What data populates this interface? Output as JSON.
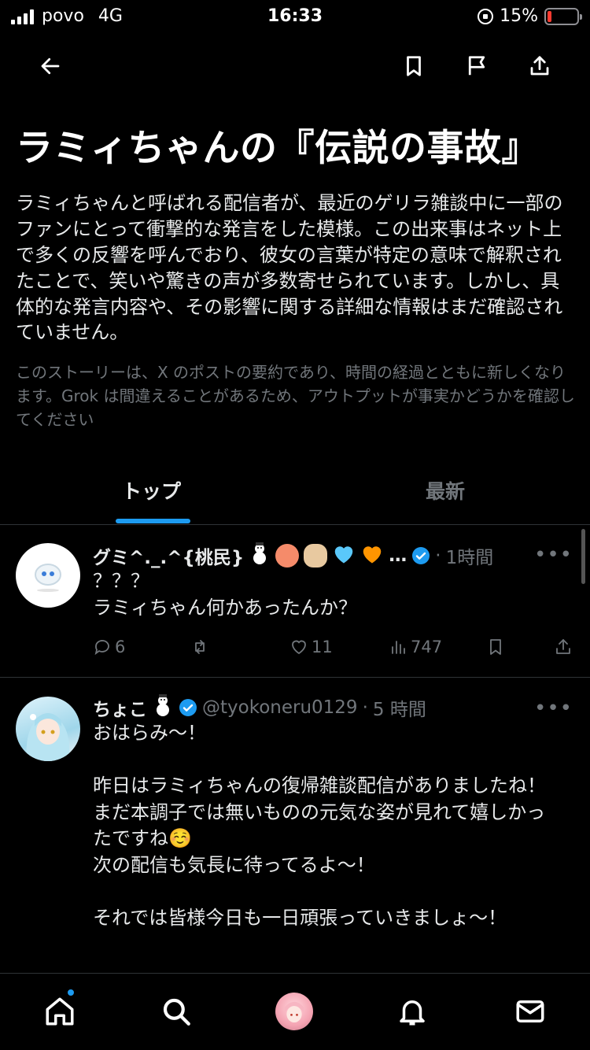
{
  "status": {
    "carrier": "povo",
    "network": "4G",
    "time": "16:33",
    "battery": "15%",
    "battery_level": 0.15
  },
  "headline": "ラミィちゃんの『伝説の事故』",
  "summary": "ラミィちゃんと呼ばれる配信者が、最近のゲリラ雑談中に一部のファンにとって衝撃的な発言をした模様。この出来事はネット上で多くの反響を呼んでおり、彼女の言葉が特定の意味で解釈されたことで、笑いや驚きの声が多数寄せられています。しかし、具体的な発言内容や、その影響に関する詳細な情報はまだ確認されていません。",
  "disclaimer": "このストーリーは、X のポストの要約であり、時間の経過とともに新しくなります。Grok は間違えることがあるため、アウトプットが事実かどうかを確認してください",
  "tabs": {
    "top": "トップ",
    "latest": "最新"
  },
  "posts": [
    {
      "name": "グミ^._.^{桃民}",
      "emoji_tail": "…",
      "time": "1時間",
      "body": "？？？\nラミィちゃん何かあったんか？",
      "replies": "6",
      "retweets": "",
      "likes": "11",
      "views": "747"
    },
    {
      "name": "ちょこ",
      "handle": "@tyokoneru0129",
      "time": "5 時間",
      "body": "おはらみ〜！\n\n昨日はラミィちゃんの復帰雑談配信がありましたね！\nまだ本調子では無いものの元気な姿が見れて嬉しかったですね☺️\n次の配信も気長に待ってるよ〜！\n\nそれでは皆様今日も一日頑張っていきましょ〜！"
    }
  ],
  "colors": {
    "accent": "#1d9bf0",
    "muted": "#71767b",
    "text": "#e7e9ea",
    "background": "#000000"
  },
  "icons": {
    "top": [
      "back-arrow-icon",
      "bookmark-icon",
      "flag-icon",
      "share-icon"
    ],
    "bottom": [
      "home-icon",
      "search-icon",
      "grok-avatar",
      "notifications-icon",
      "messages-icon"
    ]
  }
}
